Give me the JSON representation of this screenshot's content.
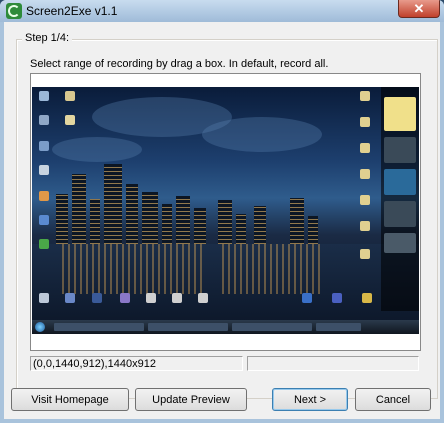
{
  "window": {
    "title": "Screen2Exe v1.1",
    "close_glyph": "✕",
    "app_icon": "screen2exe-icon"
  },
  "step": {
    "label": "Step 1/4:",
    "instruction": "Select range of recording by drag a box. In default, record all."
  },
  "status": {
    "range": "(0,0,1440,912),1440x912",
    "secondary": ""
  },
  "buttons": {
    "visit_homepage": "Visit Homepage",
    "update_preview": "Update Preview",
    "next": "Next >",
    "cancel": "Cancel"
  },
  "colors": {
    "close_button": "#c0402b",
    "default_button_border": "#3c7fb1"
  }
}
